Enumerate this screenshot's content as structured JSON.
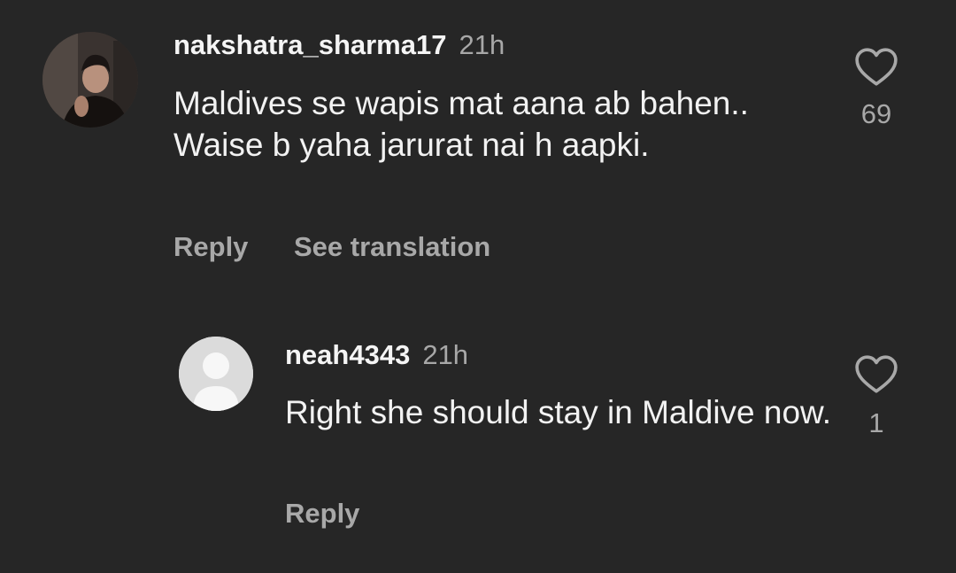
{
  "comments": [
    {
      "username": "nakshatra_sharma17",
      "time": "21h",
      "text": "Maldives se wapis mat aana ab bahen.. Waise b yaha jarurat nai h aapki.",
      "actions": {
        "reply": "Reply",
        "translate": "See translation"
      },
      "likes": "69",
      "avatar": "user-photo"
    },
    {
      "username": "neah4343",
      "time": "21h",
      "text": "Right she should stay in Maldive now.",
      "actions": {
        "reply": "Reply"
      },
      "likes": "1",
      "avatar": "default-avatar"
    }
  ],
  "icons": {
    "like": "heart-outline-icon"
  },
  "colors": {
    "background": "#262626",
    "text": "#f2f2f2",
    "muted": "#a8a8a8"
  }
}
